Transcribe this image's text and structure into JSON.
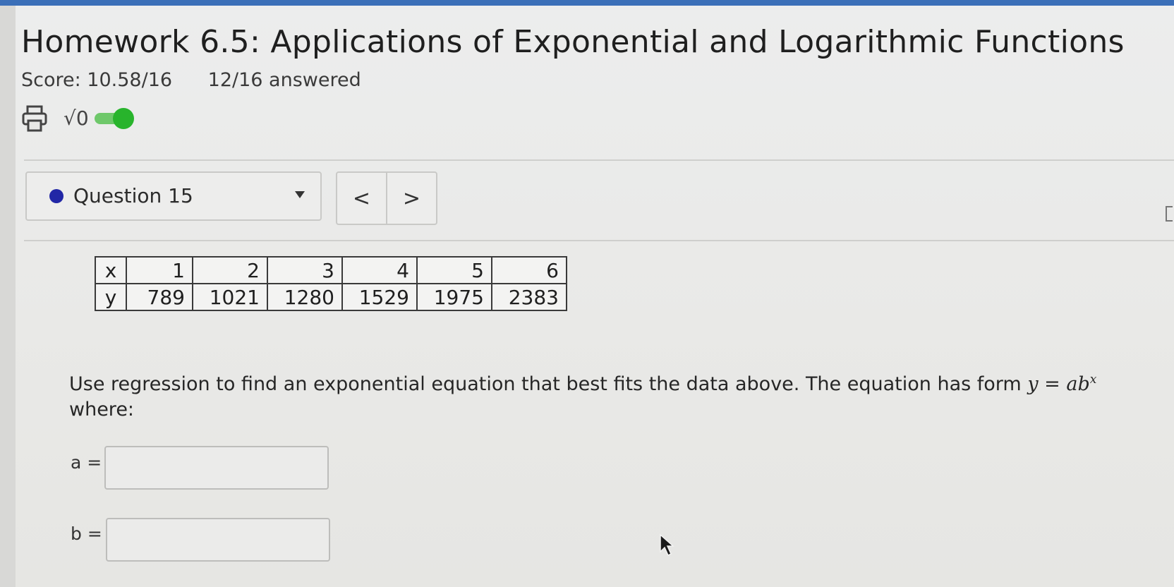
{
  "header": {
    "title": "Homework 6.5: Applications of Exponential and Logarithmic Functions",
    "score": "Score: 10.58/16",
    "answered": "12/16 answered"
  },
  "toolbar": {
    "print_icon": "printer-icon",
    "math_icon": "√0",
    "math_toggle_on": true
  },
  "question_nav": {
    "selected": "Question 15",
    "prev_label": "<",
    "next_label": ">"
  },
  "table": {
    "row_x": [
      "x",
      "1",
      "2",
      "3",
      "4",
      "5",
      "6"
    ],
    "row_y": [
      "y",
      "789",
      "1021",
      "1280",
      "1529",
      "1975",
      "2383"
    ]
  },
  "question": {
    "prompt_text": "Use regression to find an exponential equation that best fits the data above. The equation has form",
    "prompt_math": "y = ab",
    "prompt_math_sup": "x",
    "prompt_end": "where:",
    "fields": [
      {
        "label": "a =",
        "value": ""
      },
      {
        "label": "b =",
        "value": ""
      }
    ]
  },
  "colors": {
    "accent_blue": "#3b6fb8",
    "question_dot": "#2227a6",
    "toggle_green": "#28b42c"
  }
}
